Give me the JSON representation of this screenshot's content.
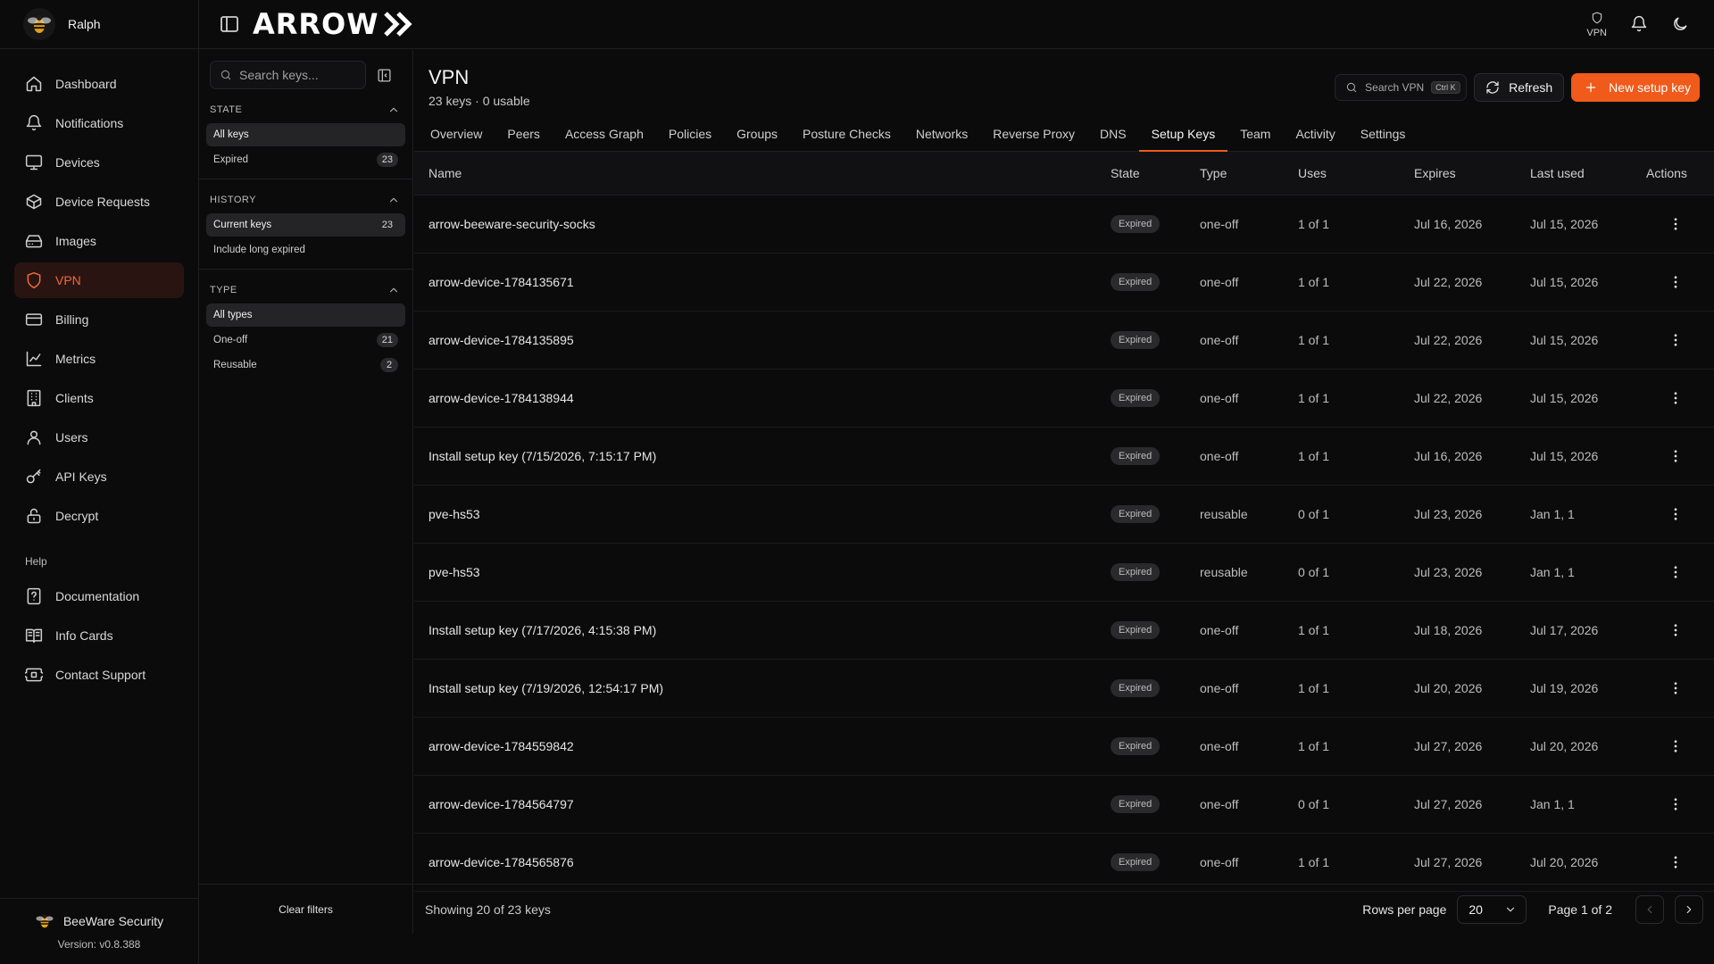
{
  "colors": {
    "accent": "#f05a1a",
    "active_nav_bg": "#2a1411",
    "background": "#0b0b0c"
  },
  "user": {
    "name": "Ralph"
  },
  "topbar": {
    "logo_text": "ARROW",
    "vpn_label": "VPN"
  },
  "nav": {
    "items": [
      {
        "label": "Dashboard",
        "icon": "home-icon"
      },
      {
        "label": "Notifications",
        "icon": "bell-icon"
      },
      {
        "label": "Devices",
        "icon": "monitor-icon"
      },
      {
        "label": "Device Requests",
        "icon": "package-icon"
      },
      {
        "label": "Images",
        "icon": "drive-icon"
      },
      {
        "label": "VPN",
        "icon": "shield-icon"
      },
      {
        "label": "Billing",
        "icon": "credit-card-icon"
      },
      {
        "label": "Metrics",
        "icon": "line-chart-icon"
      },
      {
        "label": "Clients",
        "icon": "building-icon"
      },
      {
        "label": "Users",
        "icon": "user-icon"
      },
      {
        "label": "API Keys",
        "icon": "key-icon"
      },
      {
        "label": "Decrypt",
        "icon": "lock-icon"
      }
    ],
    "help_section": "Help",
    "help_items": [
      {
        "label": "Documentation",
        "icon": "help-file-icon"
      },
      {
        "label": "Info Cards",
        "icon": "book-icon"
      },
      {
        "label": "Contact Support",
        "icon": "ticket-icon"
      }
    ]
  },
  "footer": {
    "brand": "BeeWare Security",
    "version": "Version: v0.8.388"
  },
  "filters": {
    "search_placeholder": "Search keys...",
    "groups": [
      {
        "title": "STATE",
        "options": [
          {
            "label": "All keys",
            "count": ""
          },
          {
            "label": "Expired",
            "count": "23"
          }
        ]
      },
      {
        "title": "HISTORY",
        "options": [
          {
            "label": "Current keys",
            "count": "23"
          },
          {
            "label": "Include long expired",
            "count": ""
          }
        ]
      },
      {
        "title": "TYPE",
        "options": [
          {
            "label": "All types",
            "count": ""
          },
          {
            "label": "One-off",
            "count": "21"
          },
          {
            "label": "Reusable",
            "count": "2"
          }
        ]
      }
    ],
    "clear_label": "Clear filters"
  },
  "page": {
    "title": "VPN",
    "subtitle": "23 keys · 0 usable",
    "search_label": "Search VPN",
    "search_shortcut": "Ctrl K",
    "refresh_label": "Refresh",
    "new_key_label": "New setup key",
    "active_tab": "Setup Keys",
    "tabs": [
      "Overview",
      "Peers",
      "Access Graph",
      "Policies",
      "Groups",
      "Posture Checks",
      "Networks",
      "Reverse Proxy",
      "DNS",
      "Setup Keys",
      "Team",
      "Activity",
      "Settings"
    ]
  },
  "table": {
    "columns": [
      "Name",
      "State",
      "Type",
      "Uses",
      "Expires",
      "Last used",
      "Actions"
    ],
    "rows": [
      {
        "name": "arrow-beeware-security-socks",
        "state": "Expired",
        "type": "one-off",
        "uses": "1 of 1",
        "expires": "Jul 16, 2026",
        "last_used": "Jul 15, 2026"
      },
      {
        "name": "arrow-device-1784135671",
        "state": "Expired",
        "type": "one-off",
        "uses": "1 of 1",
        "expires": "Jul 22, 2026",
        "last_used": "Jul 15, 2026"
      },
      {
        "name": "arrow-device-1784135895",
        "state": "Expired",
        "type": "one-off",
        "uses": "1 of 1",
        "expires": "Jul 22, 2026",
        "last_used": "Jul 15, 2026"
      },
      {
        "name": "arrow-device-1784138944",
        "state": "Expired",
        "type": "one-off",
        "uses": "1 of 1",
        "expires": "Jul 22, 2026",
        "last_used": "Jul 15, 2026"
      },
      {
        "name": "Install setup key (7/15/2026, 7:15:17 PM)",
        "state": "Expired",
        "type": "one-off",
        "uses": "1 of 1",
        "expires": "Jul 16, 2026",
        "last_used": "Jul 15, 2026"
      },
      {
        "name": "pve-hs53",
        "state": "Expired",
        "type": "reusable",
        "uses": "0 of 1",
        "expires": "Jul 23, 2026",
        "last_used": "Jan 1, 1"
      },
      {
        "name": "pve-hs53",
        "state": "Expired",
        "type": "reusable",
        "uses": "0 of 1",
        "expires": "Jul 23, 2026",
        "last_used": "Jan 1, 1"
      },
      {
        "name": "Install setup key (7/17/2026, 4:15:38 PM)",
        "state": "Expired",
        "type": "one-off",
        "uses": "1 of 1",
        "expires": "Jul 18, 2026",
        "last_used": "Jul 17, 2026"
      },
      {
        "name": "Install setup key (7/19/2026, 12:54:17 PM)",
        "state": "Expired",
        "type": "one-off",
        "uses": "1 of 1",
        "expires": "Jul 20, 2026",
        "last_used": "Jul 19, 2026"
      },
      {
        "name": "arrow-device-1784559842",
        "state": "Expired",
        "type": "one-off",
        "uses": "1 of 1",
        "expires": "Jul 27, 2026",
        "last_used": "Jul 20, 2026"
      },
      {
        "name": "arrow-device-1784564797",
        "state": "Expired",
        "type": "one-off",
        "uses": "0 of 1",
        "expires": "Jul 27, 2026",
        "last_used": "Jan 1, 1"
      },
      {
        "name": "arrow-device-1784565876",
        "state": "Expired",
        "type": "one-off",
        "uses": "1 of 1",
        "expires": "Jul 27, 2026",
        "last_used": "Jul 20, 2026"
      }
    ]
  },
  "pagination": {
    "showing": "Showing 20 of 23 keys",
    "rows_per_page_label": "Rows per page",
    "rows_per_page": "20",
    "page_label": "Page 1 of 2"
  }
}
